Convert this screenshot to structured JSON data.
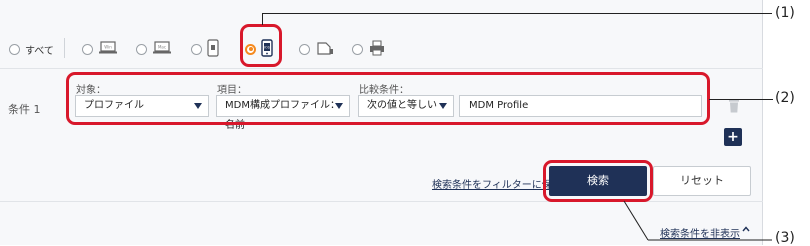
{
  "radio_options": [
    {
      "label": "すべて",
      "icon": "all",
      "checked": false
    },
    {
      "label": "",
      "icon": "windows-laptop-icon",
      "checked": false
    },
    {
      "label": "",
      "icon": "mac-laptop-icon",
      "checked": false
    },
    {
      "label": "",
      "icon": "android-phone-icon",
      "checked": false
    },
    {
      "label": "",
      "icon": "ios-phone-icon",
      "checked": true
    },
    {
      "label": "",
      "icon": "scanner-icon",
      "checked": false
    },
    {
      "label": "",
      "icon": "printer-icon",
      "checked": false
    }
  ],
  "condition": {
    "row_label": "条件 1",
    "target_head": "対象：",
    "item_head": "項目：",
    "compare_head": "比較条件：",
    "target_value": "プロファイル",
    "item_value": "MDM構成プロファイル：名前",
    "compare_value": "次の値と等しい",
    "text_value": "MDM Profile"
  },
  "actions": {
    "save_filter_link": "検索条件をフィルターに保存",
    "search_button": "検索",
    "reset_button": "リセット",
    "hide_link": "検索条件を非表示",
    "hide_chevron": "^"
  },
  "callouts": {
    "c1": "(1)",
    "c2": "(2)",
    "c3": "(3)"
  },
  "colors": {
    "accent_navy": "#1f3157",
    "radio_checked": "#f58a1f",
    "highlight_red": "#d8182b"
  }
}
